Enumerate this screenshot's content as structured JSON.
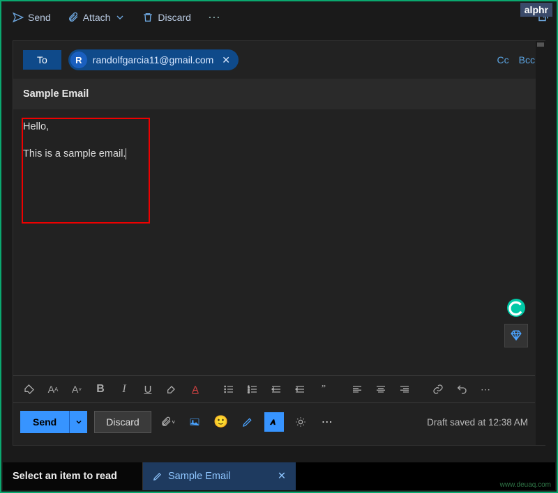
{
  "watermark_brand": "alphr",
  "toolbar": {
    "send_label": "Send",
    "attach_label": "Attach",
    "discard_label": "Discard"
  },
  "recipients": {
    "to_label": "To",
    "chip_initial": "R",
    "chip_email": "randolfgarcia11@gmail.com",
    "cc_label": "Cc",
    "bcc_label": "Bcc"
  },
  "subject": "Sample Email",
  "body": {
    "line1": "Hello,",
    "line2": "This is a sample email."
  },
  "bottom_send": {
    "send_label": "Send",
    "discard_label": "Discard",
    "draft_status": "Draft saved at 12:38 AM"
  },
  "tabs": {
    "reading_pane": "Select an item to read",
    "draft_tab": "Sample Email"
  },
  "watermark_site": "www.deuaq.com"
}
